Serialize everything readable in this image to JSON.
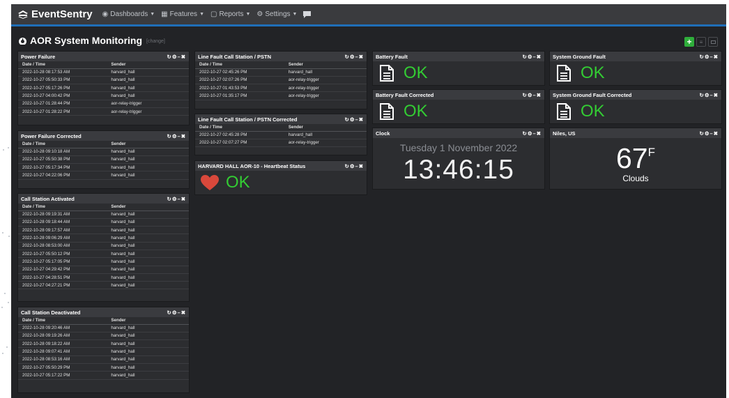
{
  "brand": "EventSentry",
  "nav": [
    "Dashboards",
    "Features",
    "Reports",
    "Settings"
  ],
  "page": {
    "title": "AOR System Monitoring",
    "change_label": "[change]"
  },
  "colors": {
    "accent": "#1f6fb8",
    "ok_green": "#33cc33",
    "heart_red": "#d9483b",
    "add_button": "#2fae3b"
  },
  "icons": {
    "brand": "eventsentry-logo-icon",
    "dashboards": "dashboard-icon",
    "features": "grid-icon",
    "reports": "reports-icon",
    "settings": "gears-icon",
    "chat": "chat-icon",
    "page": "dashboard-icon",
    "add": "plus-icon",
    "list": "list-icon",
    "screen": "monitor-icon",
    "doc": "document-icon",
    "heart": "heart-icon"
  },
  "panels": {
    "power_failure": {
      "title": "Power Failure",
      "headers": [
        "Date / Time",
        "Sender"
      ],
      "rows": [
        [
          "2022-10-28 08:17:53 AM",
          "harvard_hall"
        ],
        [
          "2022-10-27 05:50:33 PM",
          "harvard_hall"
        ],
        [
          "2022-10-27 05:17:26 PM",
          "harvard_hall"
        ],
        [
          "2022-10-27 04:00:42 PM",
          "harvard_hall"
        ],
        [
          "2022-10-27 01:28:44 PM",
          "aor-relay-trigger"
        ],
        [
          "2022-10-27 01:28:22 PM",
          "aor-relay-trigger"
        ]
      ]
    },
    "power_failure_corrected": {
      "title": "Power Failure Corrected",
      "headers": [
        "Date / Time",
        "Sender"
      ],
      "rows": [
        [
          "2022-10-28 09:10:18 AM",
          "harvard_hall"
        ],
        [
          "2022-10-27 05:50:38 PM",
          "harvard_hall"
        ],
        [
          "2022-10-27 05:17:34 PM",
          "harvard_hall"
        ],
        [
          "2022-10-27 04:22:06 PM",
          "harvard_hall"
        ]
      ]
    },
    "call_station_activated": {
      "title": "Call Station Activated",
      "headers": [
        "Date / Time",
        "Sender"
      ],
      "rows": [
        [
          "2022-10-28 09:19:31 AM",
          "harvard_hall"
        ],
        [
          "2022-10-28 09:18:44 AM",
          "harvard_hall"
        ],
        [
          "2022-10-28 09:17:57 AM",
          "harvard_hall"
        ],
        [
          "2022-10-28 09:06:29 AM",
          "harvard_hall"
        ],
        [
          "2022-10-28 08:53:00 AM",
          "harvard_hall"
        ],
        [
          "2022-10-27 05:50:12 PM",
          "harvard_hall"
        ],
        [
          "2022-10-27 05:17:05 PM",
          "harvard_hall"
        ],
        [
          "2022-10-27 04:29:42 PM",
          "harvard_hall"
        ],
        [
          "2022-10-27 04:28:51 PM",
          "harvard_hall"
        ],
        [
          "2022-10-27 04:27:21 PM",
          "harvard_hall"
        ]
      ]
    },
    "call_station_deactivated": {
      "title": "Call Station Deactivated",
      "headers": [
        "Date / Time",
        "Sender"
      ],
      "rows": [
        [
          "2022-10-28 09:20:46 AM",
          "harvard_hall"
        ],
        [
          "2022-10-28 09:19:26 AM",
          "harvard_hall"
        ],
        [
          "2022-10-28 09:18:22 AM",
          "harvard_hall"
        ],
        [
          "2022-10-28 09:07:41 AM",
          "harvard_hall"
        ],
        [
          "2022-10-28 08:53:16 AM",
          "harvard_hall"
        ],
        [
          "2022-10-27 05:50:29 PM",
          "harvard_hall"
        ],
        [
          "2022-10-27 05:17:22 PM",
          "harvard_hall"
        ]
      ]
    },
    "line_fault": {
      "title": "Line Fault Call Station / PSTN",
      "headers": [
        "Date / Time",
        "Sender"
      ],
      "rows": [
        [
          "2022-10-27 02:45:26 PM",
          "harvard_hall"
        ],
        [
          "2022-10-27 02:07:26 PM",
          "aor-relay-trigger"
        ],
        [
          "2022-10-27 01:43:53 PM",
          "aor-relay-trigger"
        ],
        [
          "2022-10-27 01:35:17 PM",
          "aor-relay-trigger"
        ]
      ]
    },
    "line_fault_corrected": {
      "title": "Line Fault Call Station / PSTN Corrected",
      "headers": [
        "Date / Time",
        "Sender"
      ],
      "rows": [
        [
          "2022-10-27 02:45:28 PM",
          "harvard_hall"
        ],
        [
          "2022-10-27 02:07:27 PM",
          "aor-relay-trigger"
        ]
      ]
    },
    "heartbeat": {
      "title": "HARVARD HALL AOR-10 - Heartbeat Status",
      "status": "OK"
    },
    "battery_fault": {
      "title": "Battery Fault",
      "status": "OK"
    },
    "battery_fault_corrected": {
      "title": "Battery Fault Corrected",
      "status": "OK"
    },
    "ground_fault": {
      "title": "System Ground Fault",
      "status": "OK"
    },
    "ground_fault_corrected": {
      "title": "System Ground Fault Corrected",
      "status": "OK"
    },
    "clock": {
      "title": "Clock",
      "date": "Tuesday 1 November 2022",
      "time": "13:46:15"
    },
    "weather": {
      "title": "Niles, US",
      "temp": "67",
      "unit": "F",
      "condition": "Clouds"
    }
  }
}
